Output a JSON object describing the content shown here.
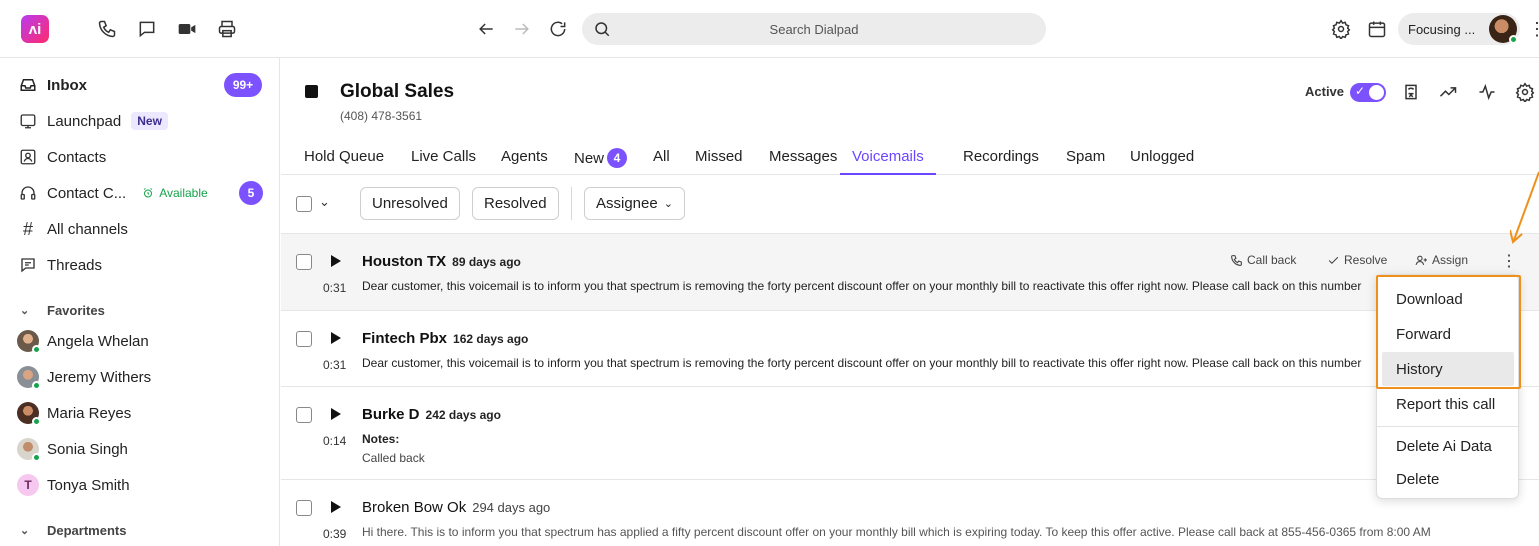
{
  "topbar": {
    "logo_text": "ʌi",
    "icons": [
      "phone-icon",
      "chat-icon",
      "video-icon",
      "print-icon",
      "back-arrow-icon",
      "forward-arrow-icon",
      "refresh-icon",
      "settings-icon",
      "calendar-icon"
    ],
    "search_placeholder": "Search Dialpad",
    "status_label": "Focusing ..."
  },
  "sidebar": {
    "items": [
      {
        "label": "Inbox",
        "badge": "99+"
      },
      {
        "label": "Launchpad",
        "tag": "New"
      },
      {
        "label": "Contacts"
      },
      {
        "label": "Contact C...",
        "status": "Available",
        "badge": "5"
      },
      {
        "label": "All channels"
      },
      {
        "label": "Threads"
      }
    ],
    "favorites_header": "Favorites",
    "favorites": [
      {
        "name": "Angela Whelan"
      },
      {
        "name": "Jeremy Withers"
      },
      {
        "name": "Maria Reyes"
      },
      {
        "name": "Sonia Singh"
      },
      {
        "name": "Tonya Smith",
        "initial": "T"
      }
    ],
    "departments_header": "Departments"
  },
  "header": {
    "title": "Global Sales",
    "phone": "(408) 478-3561",
    "active_label": "Active",
    "active": true
  },
  "tabs": [
    {
      "label": "Hold Queue"
    },
    {
      "label": "Live Calls"
    },
    {
      "label": "Agents"
    },
    {
      "label": "New",
      "count": "4"
    },
    {
      "label": "All"
    },
    {
      "label": "Missed"
    },
    {
      "label": "Messages"
    },
    {
      "label": "Voicemails",
      "active": true
    },
    {
      "label": "Recordings"
    },
    {
      "label": "Spam"
    },
    {
      "label": "Unlogged"
    }
  ],
  "filters": {
    "unresolved": "Unresolved",
    "resolved": "Resolved",
    "assignee": "Assignee"
  },
  "row_actions": {
    "call_back": "Call back",
    "resolve": "Resolve",
    "assign": "Assign"
  },
  "voicemails": [
    {
      "caller": "Houston TX",
      "ago": "89 days ago",
      "duration": "0:31",
      "text": "Dear customer, this voicemail is to inform you that spectrum is removing the forty percent discount offer on your monthly bill to reactivate this offer right now. Please call back on this number"
    },
    {
      "caller": "Fintech Pbx",
      "ago": "162 days ago",
      "duration": "0:31",
      "text": "Dear customer, this voicemail is to inform you that spectrum is removing the forty percent discount offer on your monthly bill to reactivate this offer right now. Please call back on this number"
    },
    {
      "caller": "Burke D",
      "ago": "242 days ago",
      "duration": "0:14",
      "notes_label": "Notes:",
      "notes": "Called back"
    },
    {
      "caller": "Broken Bow Ok",
      "ago": "294 days ago",
      "duration": "0:39",
      "text": "Hi there. This is to inform you that spectrum has applied a fifty percent discount offer on your monthly bill which is expiring today. To keep this offer active. Please call back at 855-456-0365 from 8:00 AM"
    }
  ],
  "menu": {
    "items": [
      "Download",
      "Forward",
      "History",
      "Report this call",
      "Delete Ai Data",
      "Delete"
    ],
    "highlighted": "History"
  },
  "colors": {
    "accent": "#7c52ff",
    "annotation": "#f0901c",
    "available": "#16a34a"
  }
}
